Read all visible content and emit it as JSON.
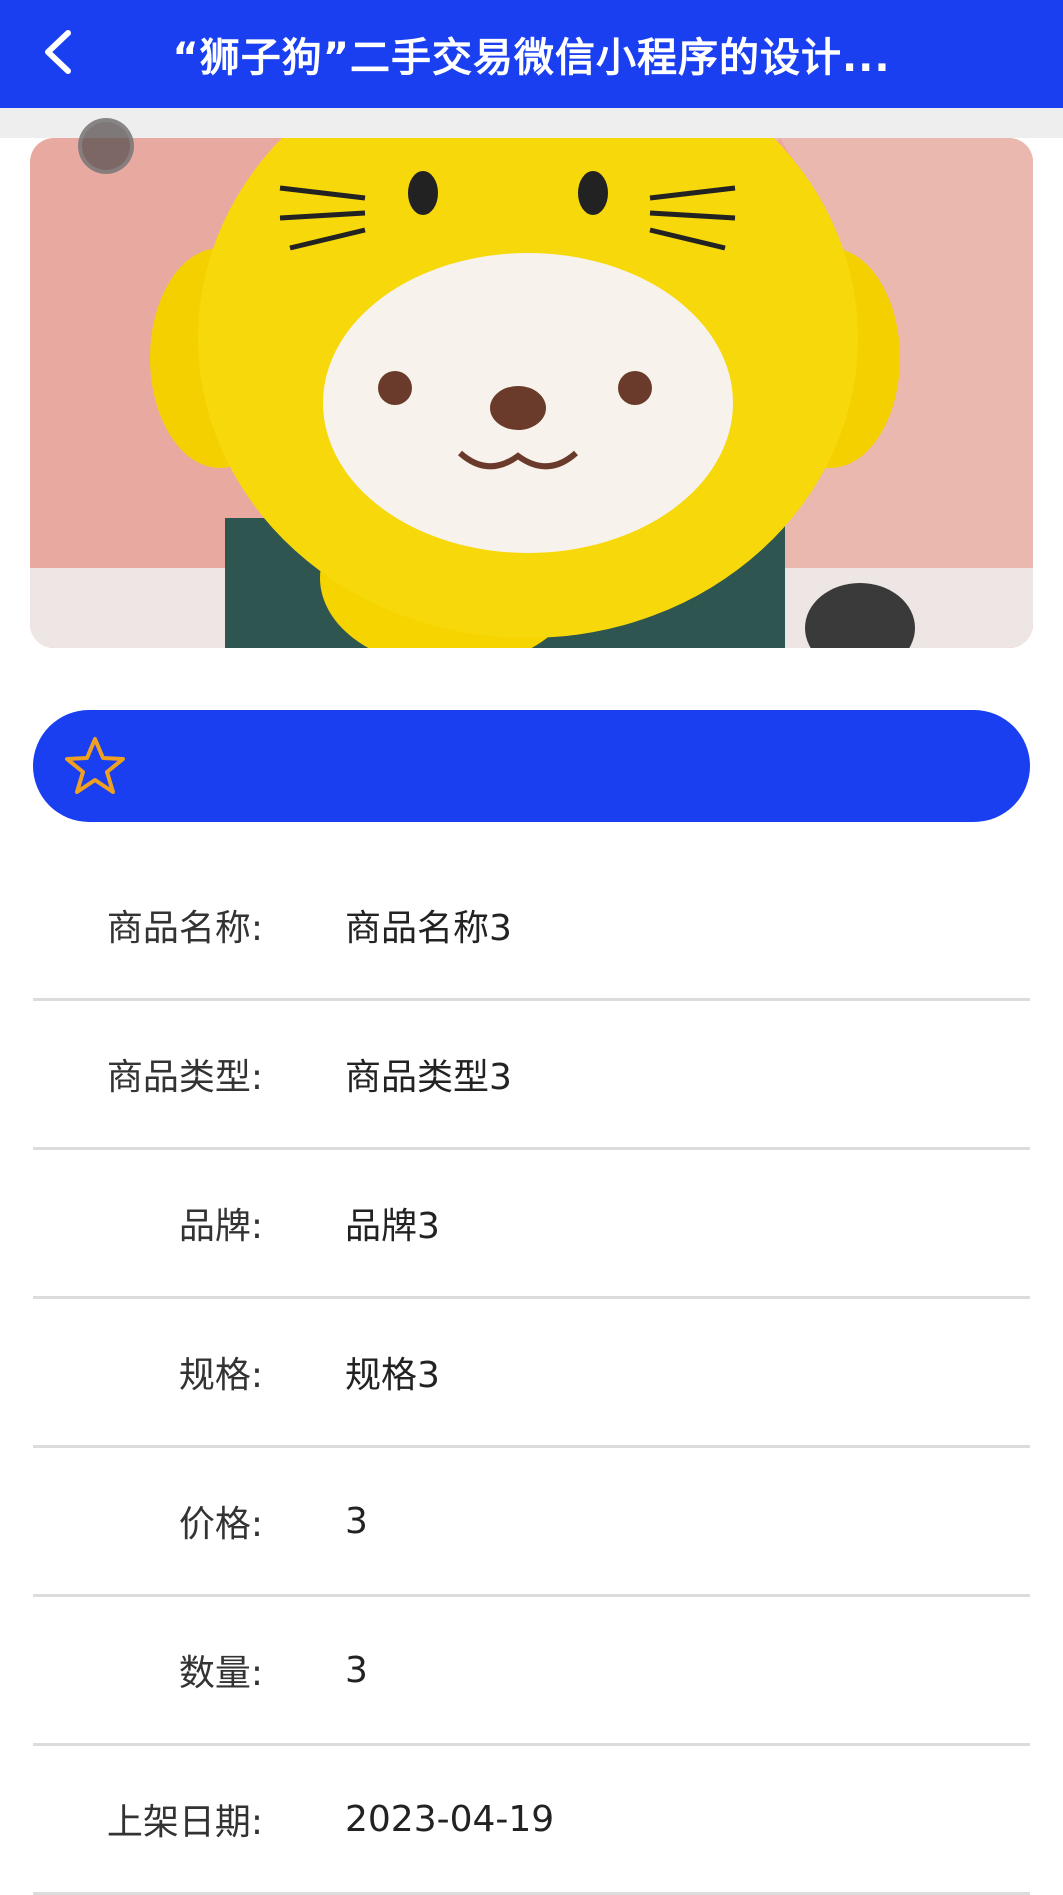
{
  "header": {
    "title": "“狮子狗”二手交易微信小程序的设计..."
  },
  "product": {
    "fields": [
      {
        "label": "商品名称:",
        "value": "商品名称3"
      },
      {
        "label": "商品类型:",
        "value": "商品类型3"
      },
      {
        "label": "品牌:",
        "value": "品牌3"
      },
      {
        "label": "规格:",
        "value": "规格3"
      },
      {
        "label": "价格:",
        "value": "3"
      },
      {
        "label": "数量:",
        "value": "3"
      },
      {
        "label": "上架日期:",
        "value": "2023-04-19"
      }
    ]
  },
  "colors": {
    "accent": "#1a3ff0",
    "star": "#f0a020"
  },
  "icons": {
    "back": "chevron-left-icon",
    "favorite": "star-outline-icon"
  }
}
